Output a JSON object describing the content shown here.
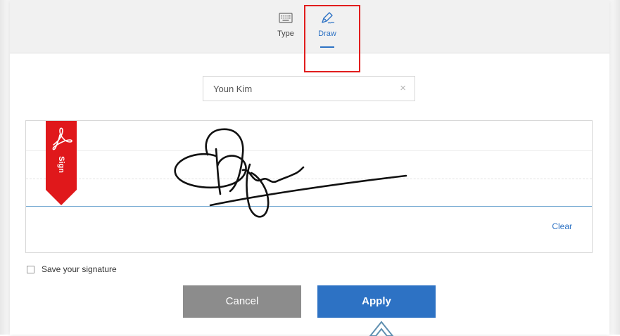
{
  "tabs": {
    "type": {
      "label": "Type",
      "icon": "keyboard-icon"
    },
    "draw": {
      "label": "Draw",
      "icon": "pen-icon",
      "active": true
    }
  },
  "name_field": {
    "value": "Youn Kim",
    "clear_icon": "×"
  },
  "signature_area": {
    "flag_label": "Sign",
    "flag_icon": "acrobat-logo-icon",
    "clear_label": "Clear"
  },
  "save_signature": {
    "label": "Save your signature",
    "checked": false
  },
  "buttons": {
    "cancel": "Cancel",
    "apply": "Apply"
  },
  "colors": {
    "accent": "#2d72c4",
    "highlight_box": "#e11d1d",
    "flag_red": "#e0181b",
    "cancel_gray": "#8c8c8c"
  }
}
